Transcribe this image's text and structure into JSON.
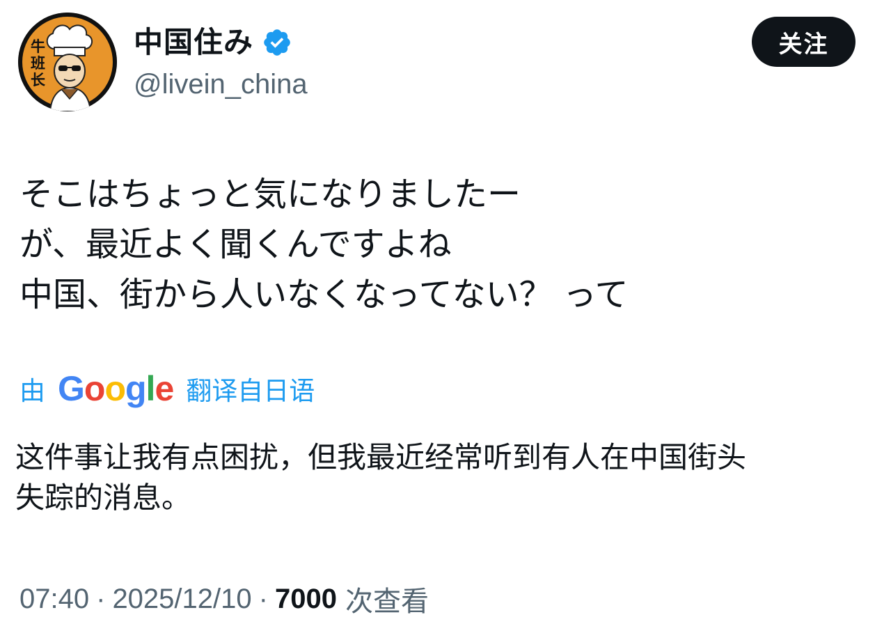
{
  "author": {
    "display_name": "中国住み",
    "handle": "@livein_china",
    "verified": true,
    "avatar_text": "牛班长",
    "verified_icon": "verified-badge-icon"
  },
  "actions": {
    "follow_label": "关注"
  },
  "tweet": {
    "original_lines": [
      "そこはちょっと気になりましたー",
      "が、最近よく聞くんですよね",
      "中国、街から人いなくなってない？ って"
    ],
    "translation_notice": {
      "prefix": "由",
      "provider": "Google",
      "suffix": "翻译自日语"
    },
    "translation_lines": [
      "这件事让我有点困扰，但我最近经常听到有人在中国街头",
      "失踪的消息。"
    ]
  },
  "meta": {
    "time": "07:40",
    "separator": "·",
    "date": "2025/12/10",
    "views_count": "7000",
    "views_label": "次查看"
  },
  "colors": {
    "text": "#0f1419",
    "secondary": "#536471",
    "link": "#1d9bf0",
    "verified": "#1d9bf0",
    "button_bg": "#0f1419",
    "avatar_bg": "#e8952b"
  }
}
